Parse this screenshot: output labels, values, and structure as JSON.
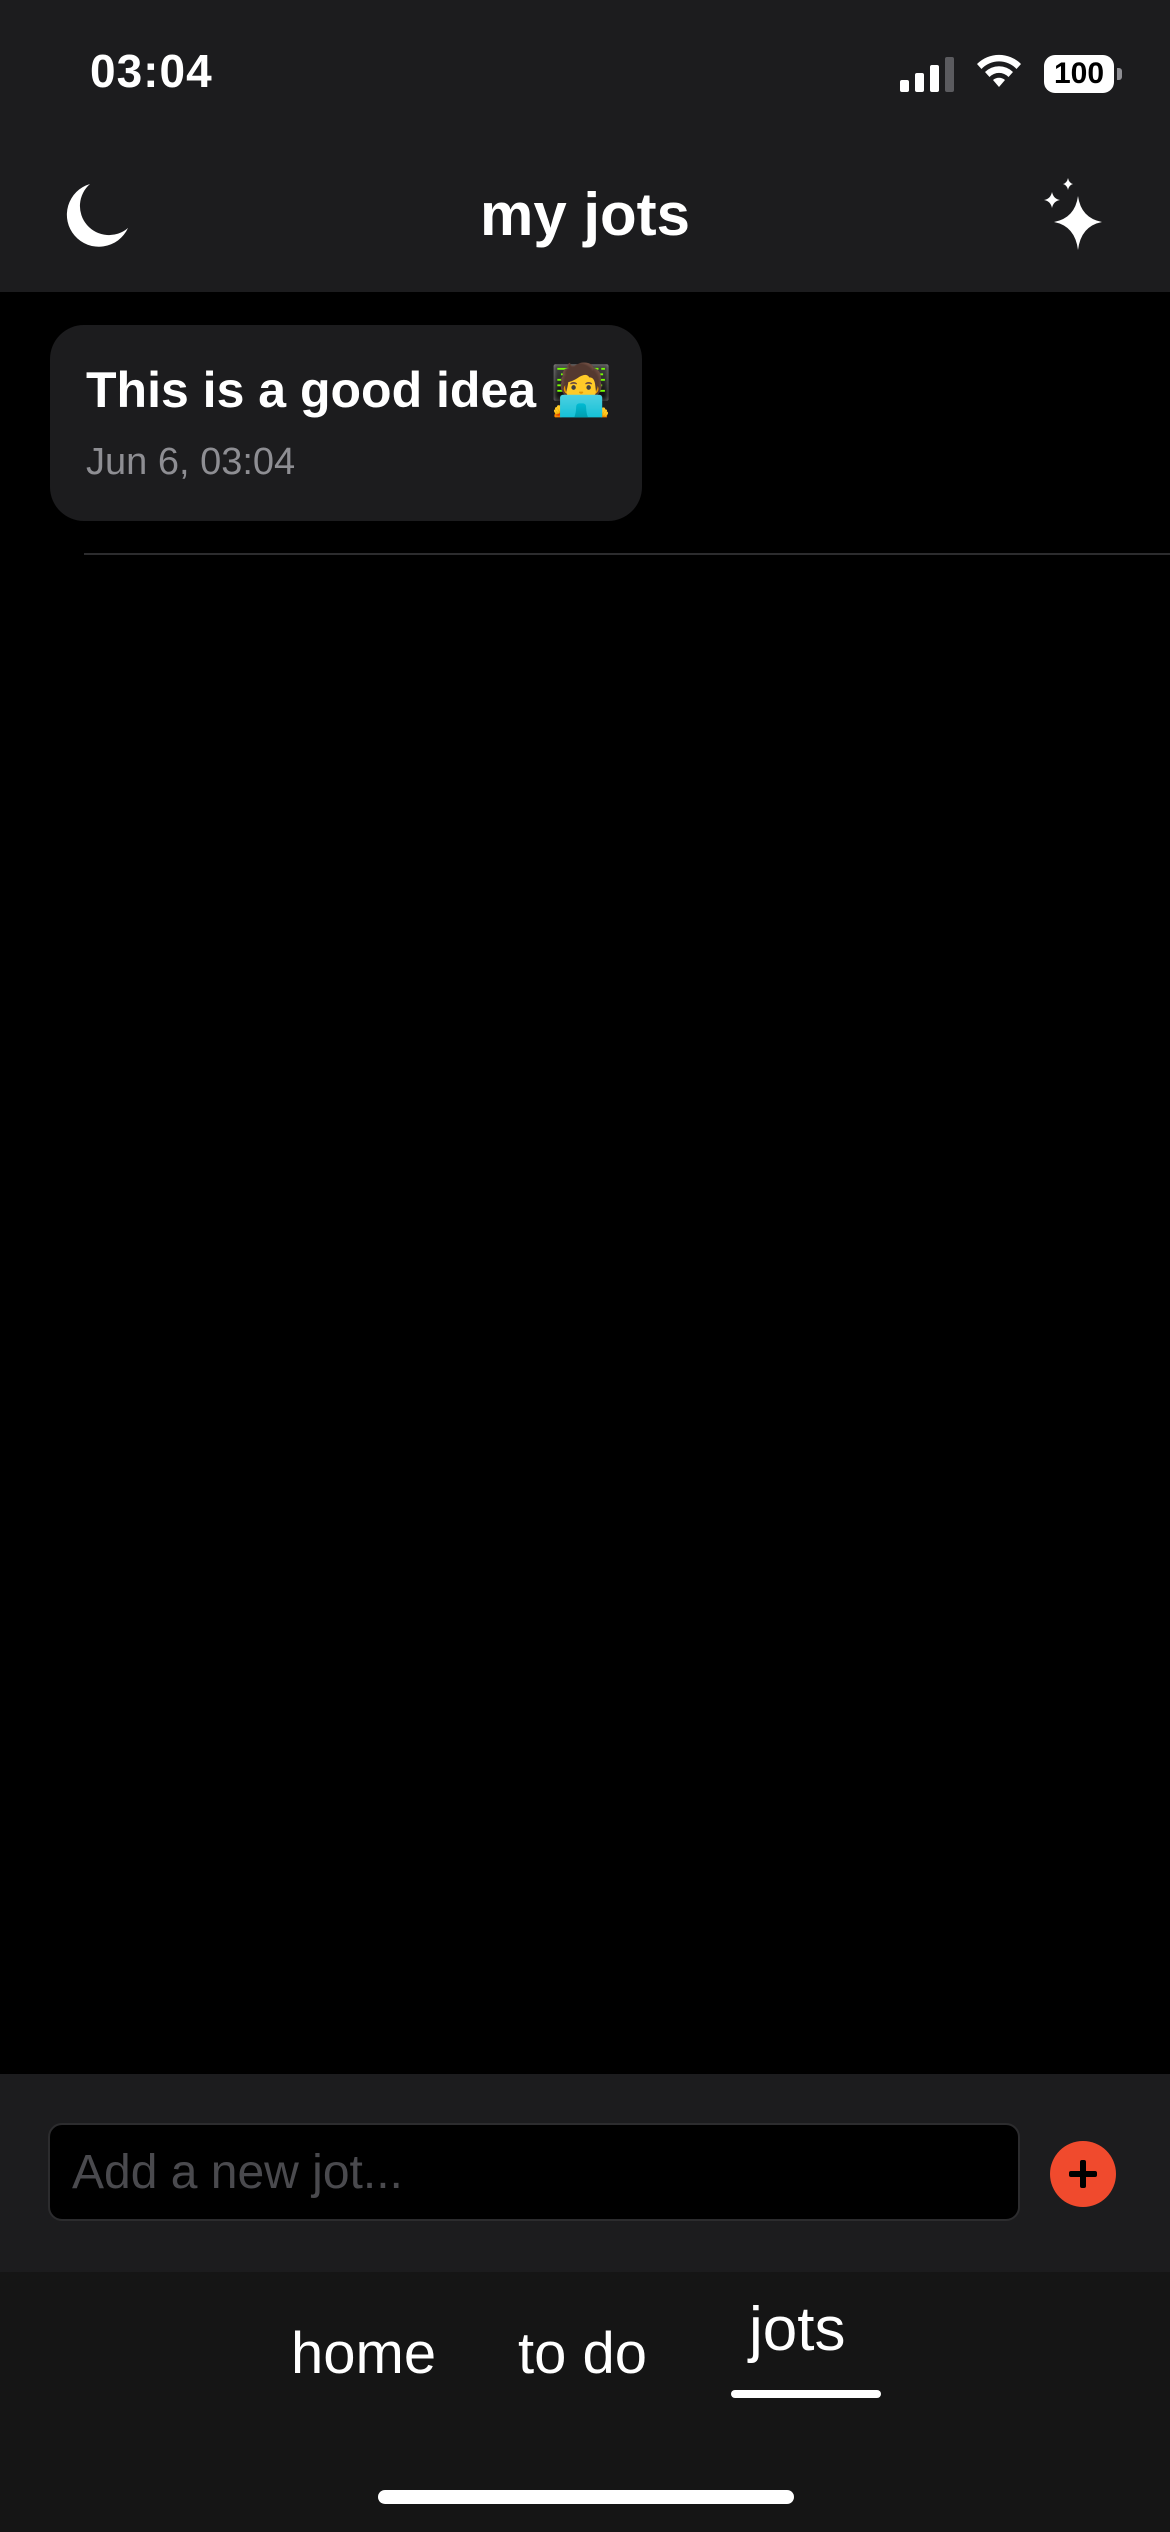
{
  "status_bar": {
    "time": "03:04",
    "battery": "100",
    "icons": [
      "signal-icon",
      "wifi-icon",
      "battery-icon"
    ]
  },
  "header": {
    "title": "my jots",
    "left_icon": "moon-icon",
    "right_icon": "sparkles-icon"
  },
  "jots": [
    {
      "text": "This is a good idea 🧑‍💻",
      "date": "Jun 6, 03:04"
    }
  ],
  "composer": {
    "placeholder": "Add a new jot...",
    "value": "",
    "add_icon": "plus-icon",
    "accent_color": "#f04a2d"
  },
  "tabs": {
    "home": "home",
    "todo": "to do",
    "jots": "jots",
    "active": "jots"
  }
}
